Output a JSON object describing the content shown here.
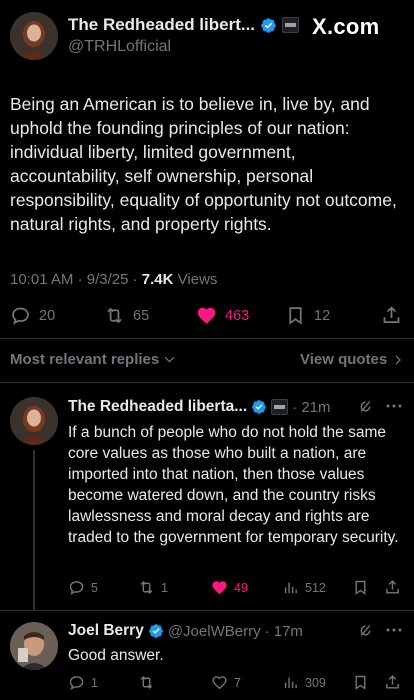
{
  "post": {
    "author_name": "The Redheaded libert...",
    "author_handle": "@TRHLofficial",
    "brand": "X.com",
    "text": "Being an American is to believe in, live by, and uphold the founding principles of our nation: individual liberty, limited government, accountability, self ownership, personal responsibility, equality of opportunity not outcome, natural rights, and property rights.",
    "time": "10:01 AM",
    "date": "9/3/25",
    "separator": "·",
    "views_count": "7.4K",
    "views_label": "Views",
    "replies": "20",
    "reposts": "65",
    "likes": "463",
    "bookmarks": "12"
  },
  "sort": {
    "label": "Most relevant replies",
    "view_quotes": "View quotes"
  },
  "replies": [
    {
      "author_name": "The Redheaded liberta...",
      "time": "· 21m",
      "text": "If a bunch of people who do not hold the same core values as those who built a nation, are imported into that nation, then those values become watered down, and the country risks lawlessness and moral decay and rights are traded to the government for temporary security.",
      "replies": "5",
      "reposts": "1",
      "likes": "49",
      "views": "512"
    },
    {
      "author_name": "Joel Berry",
      "author_handle": "@JoelWBerry",
      "time": "· 17m",
      "text": "Good answer.",
      "replies": "1",
      "reposts": "",
      "likes": "7",
      "views": "309"
    }
  ],
  "colors": {
    "background": "#000000",
    "text": "#e7e9ea",
    "muted": "#71767b",
    "like": "#f91880",
    "verified": "#1d9bf0",
    "divider": "#2f3336"
  }
}
